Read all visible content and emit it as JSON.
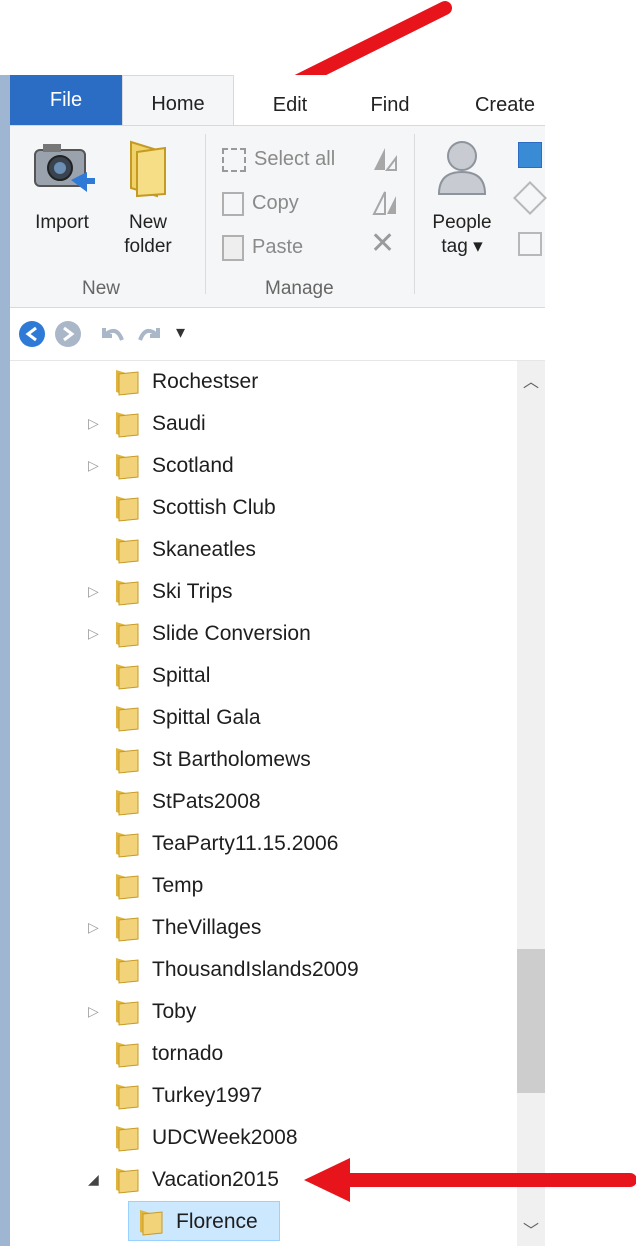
{
  "tabs": [
    "File",
    "Home",
    "Edit",
    "Find",
    "Create"
  ],
  "ribbon": {
    "import_label": "Import",
    "new_folder_label_1": "New",
    "new_folder_label_2": "folder",
    "group_new": "New",
    "select_all": "Select all",
    "copy": "Copy",
    "paste": "Paste",
    "group_manage": "Manage",
    "people_tag_1": "People",
    "people_tag_2": "tag ▾"
  },
  "nav": {
    "icons": [
      "back-icon",
      "forward-icon",
      "undo-icon",
      "redo-icon",
      "customize-dropdown-icon"
    ],
    "dropdown_glyph": "▾"
  },
  "tree": {
    "items": [
      {
        "label": "Rochestser",
        "expandable": false
      },
      {
        "label": "Saudi",
        "expandable": true
      },
      {
        "label": "Scotland",
        "expandable": true
      },
      {
        "label": "Scottish Club",
        "expandable": false
      },
      {
        "label": "Skaneatles",
        "expandable": false
      },
      {
        "label": "Ski Trips",
        "expandable": true
      },
      {
        "label": "Slide Conversion",
        "expandable": true
      },
      {
        "label": "Spittal",
        "expandable": false
      },
      {
        "label": "Spittal Gala",
        "expandable": false
      },
      {
        "label": "St Bartholomews",
        "expandable": false
      },
      {
        "label": "StPats2008",
        "expandable": false
      },
      {
        "label": "TeaParty11.15.2006",
        "expandable": false
      },
      {
        "label": "Temp",
        "expandable": false
      },
      {
        "label": "TheVillages",
        "expandable": true
      },
      {
        "label": "ThousandIslands2009",
        "expandable": false
      },
      {
        "label": "Toby",
        "expandable": true
      },
      {
        "label": "tornado",
        "expandable": false
      },
      {
        "label": "Turkey1997",
        "expandable": false
      },
      {
        "label": "UDCWeek2008",
        "expandable": false
      },
      {
        "label": "Vacation2015",
        "expandable": true,
        "expanded": true
      },
      {
        "label": "Florence",
        "expandable": false,
        "selected": true,
        "indent": true
      }
    ]
  },
  "colors": {
    "file_tab": "#2b6cc4",
    "folder": "#e8c14a",
    "selection": "#cce8ff",
    "arrow": "#e8141b"
  }
}
